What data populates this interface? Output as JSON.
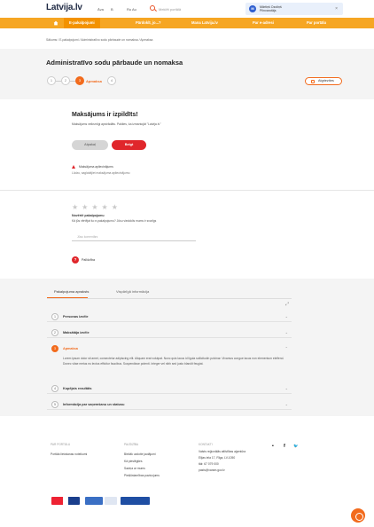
{
  "header": {
    "logo": "Latvija.lv",
    "links": [
      "Āva",
      "B",
      "Ru Au"
    ],
    "search_placeholder": "Meklēt portālā",
    "user": {
      "initial": "M",
      "name_line1": "Mārtiņš Ozoliņš",
      "name_line2": "Pilnvarotājs"
    }
  },
  "nav": {
    "items": [
      "E-pakalpojumi",
      "Pārdoklī, jo...?",
      "Mana Latvija.lv",
      "Par e-adresi",
      "Par portālu"
    ]
  },
  "breadcrumb": "Sākums  /  E-pakalpojumi  /  Administratīvo sodu pārbaude un nomaksa  /  Apmaksa",
  "page": {
    "title": "Administratīvo sodu pārbaude un nomaksa",
    "steps": [
      "1",
      "2",
      "3",
      "4"
    ],
    "active_step_label": "Apmaksa",
    "back_button": "Atgriezties"
  },
  "payment": {
    "title": "Maksājums ir izpildīts!",
    "subtitle": "Maksājums veiksmīgi apstrādāts. Paldies, ka izmantojāt \"Latvija.lv\"",
    "btn_secondary": "Atpakaļ",
    "btn_primary": "Beigt",
    "warning": "Maksājuma apliecinājums",
    "warning_sub": "Lūdzu, saglabājiet maksājuma apliecinājumu"
  },
  "rating": {
    "stars": "★★★★★",
    "title": "Novērtē pakalpojumu",
    "subtitle": "Kā jūs vērtējat šo e-pakalpojumu? Jūsu viedoklis mums ir svarīgs",
    "input_placeholder": "Jūsu komentārs",
    "help_icon": "?",
    "help_label": "Palīdzība"
  },
  "info": {
    "tabs": [
      "Pakalpojuma apraksts",
      "Vispārīgā informācija"
    ],
    "expand_icon": "⤢",
    "sections": [
      {
        "num": "1",
        "label": "Personas izvēle"
      },
      {
        "num": "2",
        "label": "Maksātāja izvēle"
      },
      {
        "num": "3",
        "label": "Apmaksa"
      },
      {
        "num": "4",
        "label": "Kopējais rezultāts"
      },
      {
        "num": "5",
        "label": "Informācija par saņemšanu un statusu"
      }
    ],
    "body": "Lorem ipsum dolor sit amet, consectetur adipiscing elit. Aliquam erat volutpat. Nunc quis lacus id ligula sollicitudin pulvinar. Vivamus congue lacus non elementum eleifend. Donec vitae metus eu lectus efficitur faucibus. Suspendisse potenti. Integer vel nibh sed justo blandit feugiat."
  },
  "footer": {
    "col1_head": "PAR PORTĀLU",
    "col1_links": [
      "Portāla lietošanas noteikumi"
    ],
    "col2_head": "PALĪDZĪBA",
    "col2_links": [
      "Biežāk uzdotie jautājumi",
      "Kā pieslēgties",
      "Saziņa ar mums",
      "Piekļūstamības paziņojums"
    ],
    "col3_head": "KONTAKTI",
    "col3_links": [
      "Valsts reģionālās attīstības aģentūra",
      "Elijas iela 17, Rīga, LV-1050",
      "tālr. 67 079 000",
      "pasts@varam.gov.lv"
    ],
    "social": [
      "▪",
      "f",
      "🐦"
    ]
  },
  "colors": {
    "accent": "#f26b1d",
    "nav": "#f6a623",
    "primary_button": "#e0262b"
  }
}
